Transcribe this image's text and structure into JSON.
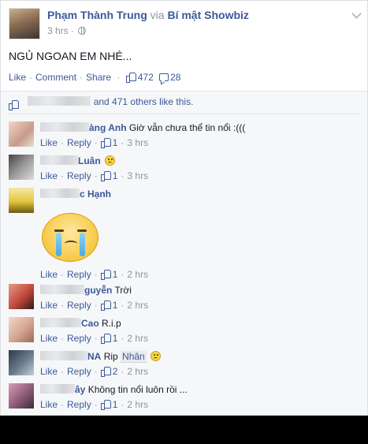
{
  "post": {
    "author": "Phạm Thành Trung",
    "via": "via",
    "group": "Bí mật Showbiz",
    "time": "3 hrs",
    "text": "NGỦ NGOAN EM NHÉ...",
    "actions": {
      "like": "Like",
      "comment": "Comment",
      "share": "Share",
      "like_count": "472",
      "comment_count": "28"
    },
    "likes_summary": "and 471 others like this."
  },
  "comments": [
    {
      "name": "àng Anh",
      "text": "Giờ vẫn chưa thể tin nổi :(((",
      "like": "Like",
      "reply": "Reply",
      "likes": "1",
      "time": "3 hrs"
    },
    {
      "name": "Luân",
      "text": "",
      "like": "Like",
      "reply": "Reply",
      "likes": "1",
      "time": "3 hrs"
    },
    {
      "name": "c Hạnh",
      "text": "",
      "like": "Like",
      "reply": "Reply",
      "likes": "1",
      "time": "2 hrs"
    },
    {
      "name": "guyễn",
      "text": "Trời",
      "like": "Like",
      "reply": "Reply",
      "likes": "1",
      "time": "2 hrs"
    },
    {
      "name": "Cao",
      "text": "R.i.p",
      "like": "Like",
      "reply": "Reply",
      "likes": "1",
      "time": "2 hrs"
    },
    {
      "name": "NA",
      "text": "Rip",
      "tag": "Nhân",
      "like": "Like",
      "reply": "Reply",
      "likes": "2",
      "time": "2 hrs"
    },
    {
      "name": "ây",
      "text": "Không tin nổi luôn rồi ...",
      "like": "Like",
      "reply": "Reply",
      "likes": "1",
      "time": "2 hrs"
    }
  ],
  "icons": {
    "like": "thumbs-up-icon",
    "comment": "speech-bubble-icon",
    "privacy": "globe-icon",
    "menu": "chevron-down-icon",
    "emoji": "slightly-frowning-emoji",
    "sticker": "crying-face-sticker"
  },
  "colors": {
    "link": "#3b5998",
    "muted": "#90949c",
    "feedback_bg": "#f6f7f9"
  }
}
